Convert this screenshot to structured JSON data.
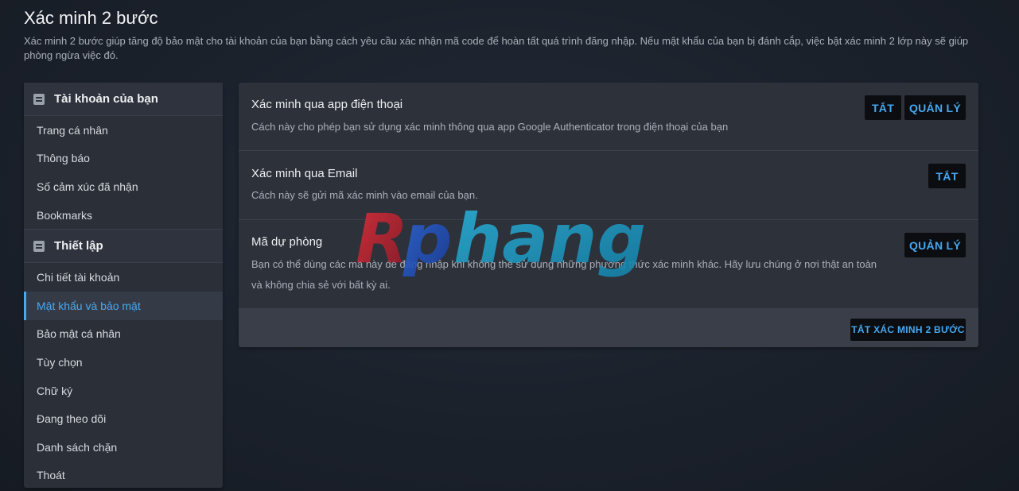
{
  "page": {
    "title": "Xác minh 2 bước",
    "description": "Xác minh 2 bước giúp tăng độ bảo mật cho tài khoản của bạn bằng cách yêu cầu xác nhận mã code để hoàn tất quá trình đăng nhập. Nếu mật khẩu của bạn bị đánh cắp, việc bật xác minh 2 lớp này sẽ giúp phòng ngừa việc đó."
  },
  "sidebar": {
    "account_header": "Tài khoản của bạn",
    "account_items": [
      "Trang cá nhân",
      "Thông báo",
      "Số cảm xúc đã nhận",
      "Bookmarks"
    ],
    "settings_header": "Thiết lập",
    "settings_items": [
      "Chi tiết tài khoản",
      "Mật khẩu và bảo mật",
      "Bảo mật cá nhân",
      "Tùy chọn",
      "Chữ ký",
      "Đang theo dõi",
      "Danh sách chặn",
      "Thoát"
    ],
    "active_item": "Mật khẩu và bảo mật"
  },
  "methods": {
    "app": {
      "title": "Xác minh qua app điện thoại",
      "description": "Cách này cho phép bạn sử dụng xác minh thông qua app Google Authenticator trong điện thoại của bạn",
      "disable_label": "TẮT",
      "manage_label": "QUẢN LÝ"
    },
    "email": {
      "title": "Xác minh qua Email",
      "description": "Cách này sẽ gửi mã xác minh vào email của bạn.",
      "disable_label": "TẮT"
    },
    "backup": {
      "title": "Mã dự phòng",
      "description": "Bạn có thể dùng các mã này để đăng nhập khi không thể sử dụng những phương thức xác minh khác. Hãy lưu chúng ở nơi thật an toàn và không chia sẻ với bất kỳ ai.",
      "manage_label": "QUẢN LÝ"
    }
  },
  "footer": {
    "disable_all_label": "TẮT XÁC MINH 2 BƯỚC"
  },
  "watermark": {
    "text": "Rphang"
  },
  "colors": {
    "accent": "#48a8f0",
    "background": "#1b212b",
    "panel": "#2c313a",
    "sidebar": "#2a2f38"
  }
}
